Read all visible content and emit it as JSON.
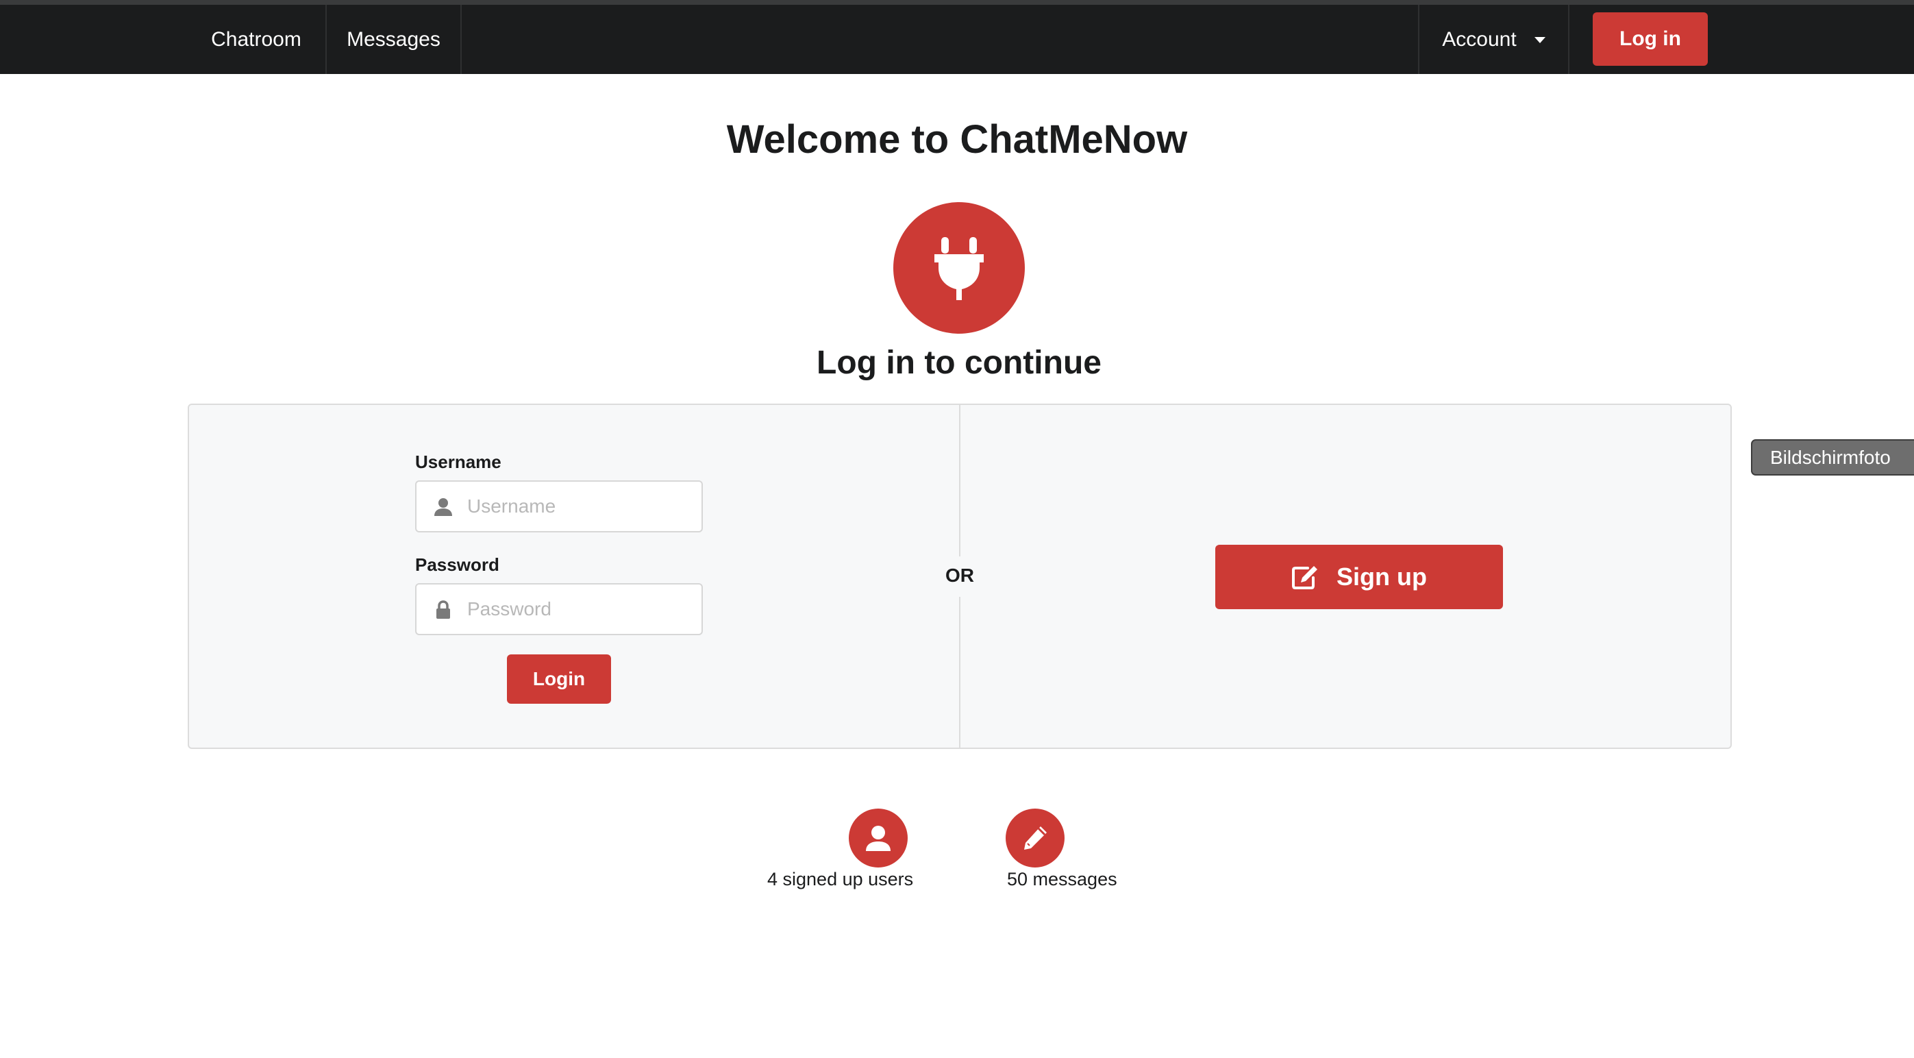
{
  "navbar": {
    "items": [
      {
        "label": "Chatroom"
      },
      {
        "label": "Messages"
      }
    ],
    "account_label": "Account",
    "login_label": "Log in"
  },
  "overlay": {
    "tooltip": "Bildschirmfoto"
  },
  "header": {
    "title": "Welcome to ChatMeNow",
    "icon": "plug-icon",
    "subtitle": "Log in to continue"
  },
  "login_form": {
    "username_label": "Username",
    "username_placeholder": "Username",
    "password_label": "Password",
    "password_placeholder": "Password",
    "submit_label": "Login"
  },
  "divider_text": "OR",
  "signup": {
    "label": "Sign up",
    "icon": "edit-icon"
  },
  "stats": [
    {
      "icon": "user-icon",
      "label": "4 signed up users"
    },
    {
      "icon": "pencil-icon",
      "label": "50 messages"
    }
  ],
  "colors": {
    "accent": "#cc3a35",
    "navbar": "#1b1c1d",
    "segment_bg": "#f7f8f9"
  }
}
